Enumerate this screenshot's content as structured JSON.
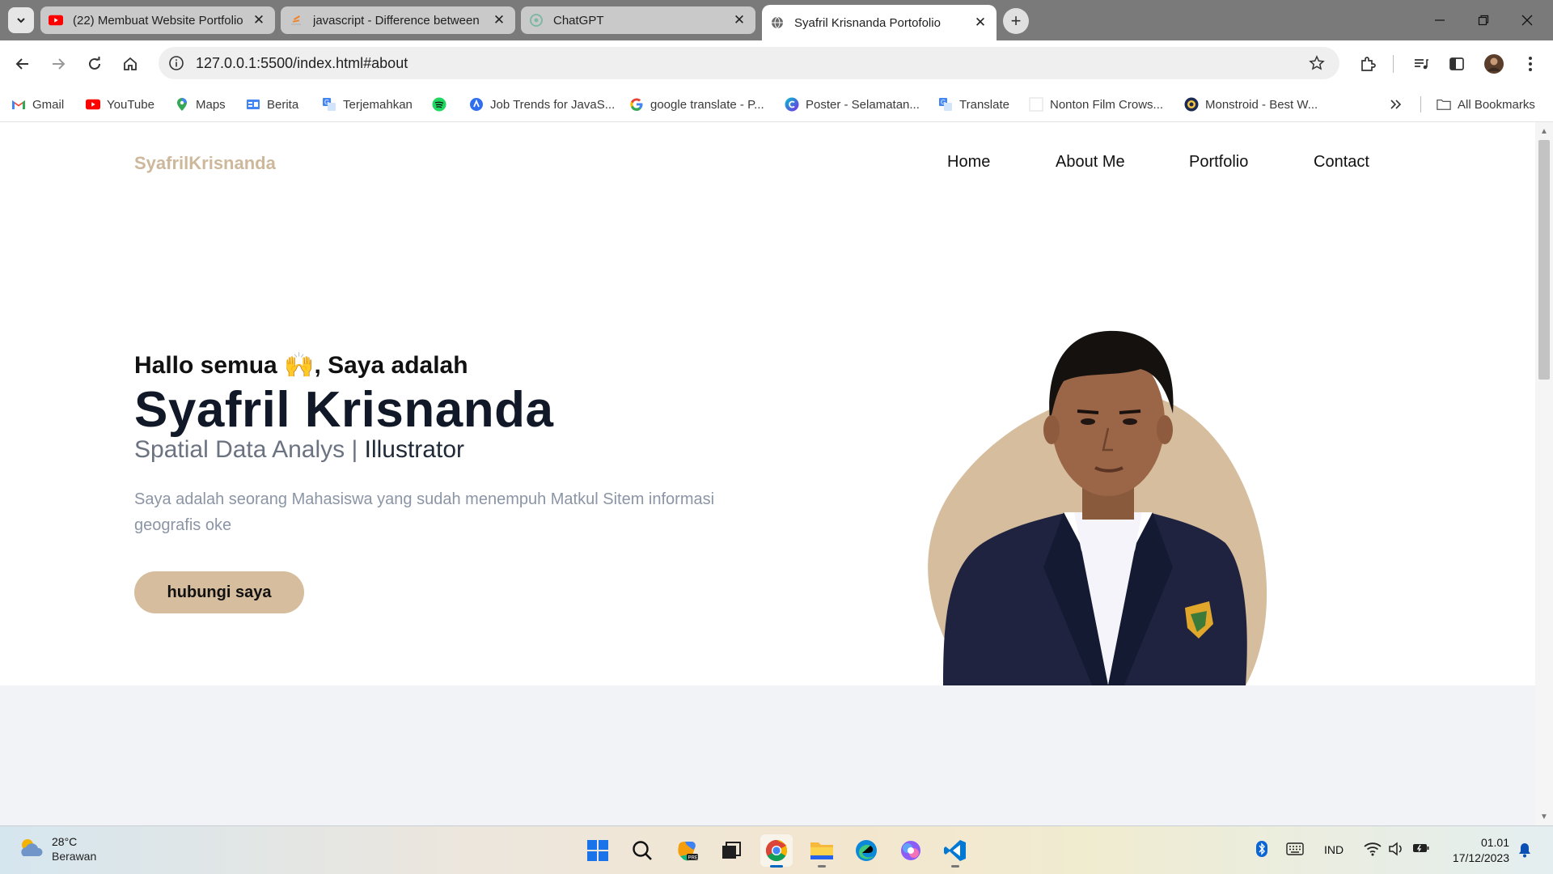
{
  "browser": {
    "tabs": [
      {
        "title": "(22) Membuat Website Portfolio",
        "favicon": "youtube-icon"
      },
      {
        "title": "javascript - Difference between",
        "favicon": "stackoverflow-icon"
      },
      {
        "title": "ChatGPT",
        "favicon": "chatgpt-icon"
      },
      {
        "title": "Syafril Krisnanda Portofolio",
        "favicon": "globe-icon"
      }
    ],
    "url": "127.0.0.1:5500/index.html#about",
    "bookmarks": [
      {
        "label": "Gmail",
        "icon": "gmail-icon"
      },
      {
        "label": "YouTube",
        "icon": "youtube-icon"
      },
      {
        "label": "Maps",
        "icon": "maps-icon"
      },
      {
        "label": "Berita",
        "icon": "news-icon"
      },
      {
        "label": "Terjemahkan",
        "icon": "translate-icon"
      },
      {
        "label": "",
        "icon": "spotify-icon"
      },
      {
        "label": "Job Trends for JavaS...",
        "icon": "jobtrends-icon"
      },
      {
        "label": "google translate - P...",
        "icon": "google-icon"
      },
      {
        "label": "Poster - Selamatan...",
        "icon": "canva-icon"
      },
      {
        "label": "Translate",
        "icon": "translate-icon"
      },
      {
        "label": "Nonton Film Crows...",
        "icon": "blank-page-icon"
      },
      {
        "label": "Monstroid - Best W...",
        "icon": "monstroid-icon"
      }
    ],
    "all_bookmarks": "All Bookmarks"
  },
  "site": {
    "logo": "SyafrilKrisnanda",
    "nav": [
      "Home",
      "About Me",
      "Portfolio",
      "Contact"
    ],
    "greeting_before": "Hallo semua ",
    "greeting_emoji": "🙌",
    "greeting_after": ", Saya adalah",
    "name": "Syafril Krisnanda",
    "role_primary": "Spatial Data Analys | ",
    "role_secondary": "Illustrator",
    "description": "Saya adalah seorang Mahasiswa yang sudah menempuh Matkul Sitem informasi geografis oke",
    "cta": "hubungi saya",
    "accent_color": "#d5bd9d"
  },
  "taskbar": {
    "weather_temp": "28°C",
    "weather_cond": "Berawan",
    "language": "IND",
    "time": "01.01",
    "date": "17/12/2023"
  }
}
